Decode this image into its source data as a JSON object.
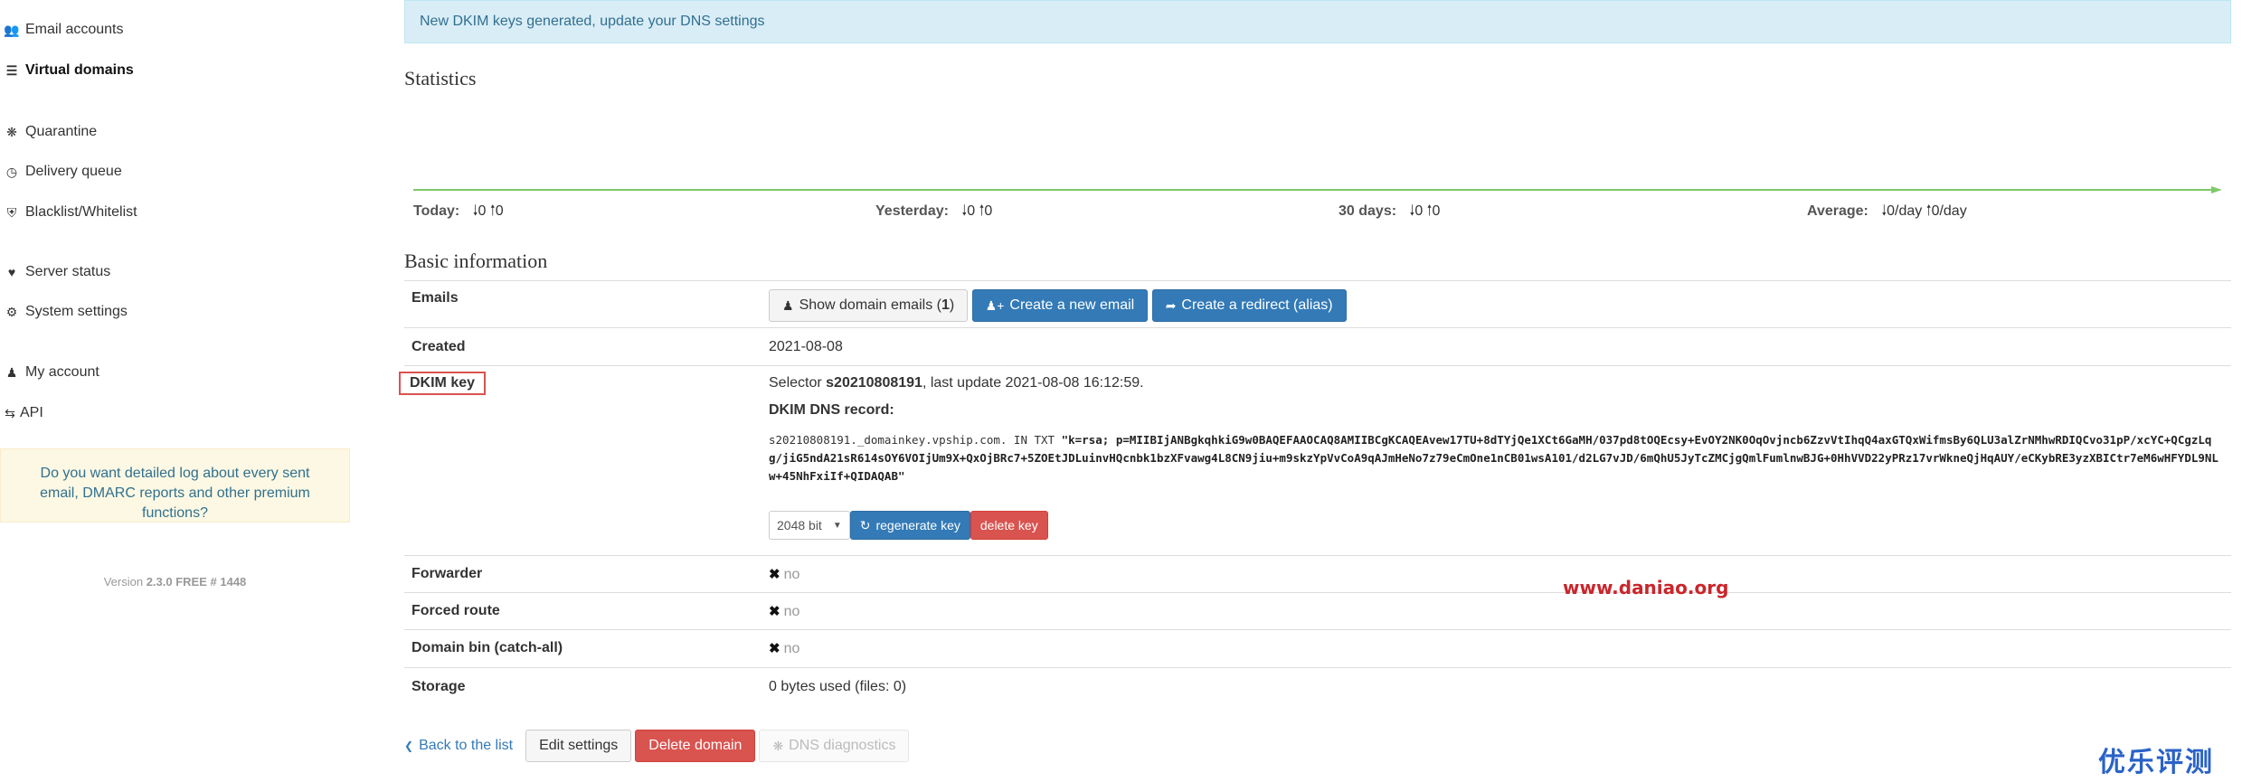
{
  "sidebar": {
    "items": [
      {
        "label": "Email accounts",
        "icon": "users-icon"
      },
      {
        "label": "Virtual domains",
        "icon": "database-icon"
      },
      {
        "label": "Quarantine",
        "icon": "bug-icon"
      },
      {
        "label": "Delivery queue",
        "icon": "clock-icon"
      },
      {
        "label": "Blacklist/Whitelist",
        "icon": "shield-icon"
      },
      {
        "label": "Server status",
        "icon": "heartbeat-icon"
      },
      {
        "label": "System settings",
        "icon": "cogs-icon"
      },
      {
        "label": "My account",
        "icon": "user-icon"
      },
      {
        "label": "API",
        "icon": "exchange-icon"
      }
    ],
    "promo": "Do you want detailed log about every sent email, DMARC reports and other premium functions?",
    "version_prefix": "Version",
    "version": "2.3.0 FREE # 1448"
  },
  "alert": "New DKIM keys generated, update your DNS settings",
  "statistics": {
    "title": "Statistics",
    "today_label": "Today:",
    "today_down": "0",
    "today_up": "0",
    "yesterday_label": "Yesterday:",
    "yesterday_down": "0",
    "yesterday_up": "0",
    "days30_label": "30 days:",
    "days30_down": "0",
    "days30_up": "0",
    "average_label": "Average:",
    "average_down": "0/day",
    "average_up": "0/day",
    "line_color": "#7ec96a"
  },
  "basic": {
    "title": "Basic information",
    "emails_label": "Emails",
    "show_emails_label": "Show domain emails (",
    "show_emails_count": "1",
    "show_emails_close": ")",
    "create_email_label": "Create a new email",
    "create_redirect_label": "Create a redirect (alias)",
    "created_label": "Created",
    "created_value": "2021-08-08",
    "dkim_label": "DKIM key",
    "selector_prefix": "Selector",
    "selector": "s20210808191",
    "last_update": ", last update 2021-08-08 16:12:59.",
    "dns_record_label": "DKIM DNS record:",
    "dns_record_prefix": "s20210808191._domainkey.vpship.com. IN TXT ",
    "dns_record_value": "\"k=rsa; p=MIIBIjANBgkqhkiG9w0BAQEFAAOCAQ8AMIIBCgKCAQEAvew17TU+8dTYjQe1XCt6GaMH/037pd8tOQEcsy+EvOY2NK0OqOvjncb6ZzvVtIhqQ4axGTQxWifmsBy6QLU3alZrNMhwRDIQCvo31pP/xcYC+QCgzLqg/jiG5ndA21sR614sOY6VOIjUm9X+QxOjBRc7+5ZOEtJDLuinvHQcnbk1bzXFvawg4L8CN9jiu+m9skzYpVvCoA9qAJmHeNo7z79eCmOne1nCB01wsA101/d2LG7vJD/6mQhU5JyTcZMCjgQmlFumlnwBJG+0HhVVD22yPRz17vrWkneQjHqAUY/eCKybRE3yzXBICtr7eM6wHFYDL9NLw+45NhFxiIf+QIDAQAB\"",
    "key_size": "2048 bit",
    "regenerate_label": "regenerate key",
    "delete_key_label": "delete key",
    "forwarder_label": "Forwarder",
    "forwarder_value": "no",
    "forced_route_label": "Forced route",
    "forced_route_value": "no",
    "domain_bin_label": "Domain bin (catch-all)",
    "domain_bin_value": "no",
    "storage_label": "Storage",
    "storage_value": "0 bytes used (files: 0)"
  },
  "actions": {
    "back_label": "Back to the list",
    "edit_label": "Edit settings",
    "delete_label": "Delete domain",
    "dns_diag_label": "DNS diagnostics"
  },
  "watermarks": {
    "site": "www.daniao.org",
    "logo": "优乐评测网"
  }
}
